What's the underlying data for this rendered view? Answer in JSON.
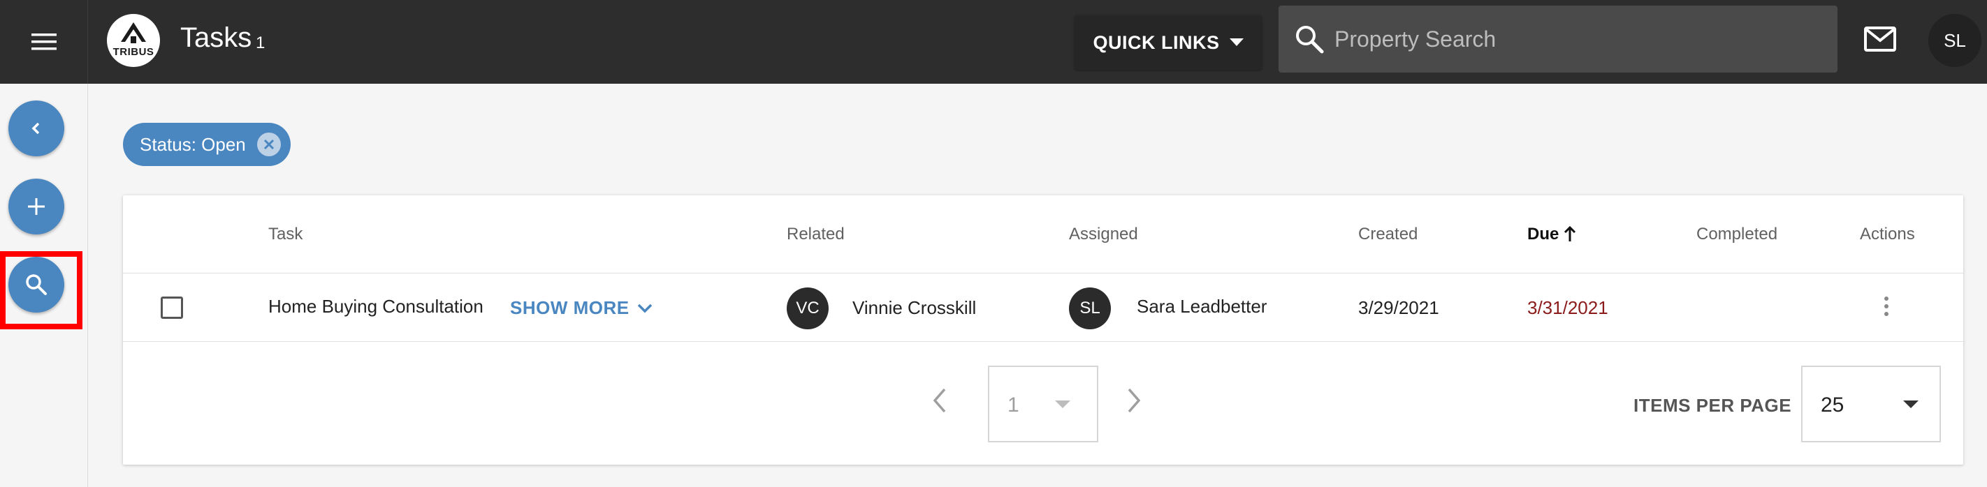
{
  "header": {
    "logo_text": "TRIBUS",
    "title": "Tasks",
    "count": "1",
    "quick_links_label": "QUICK LINKS",
    "search_placeholder": "Property Search",
    "user_initials": "SL"
  },
  "filter": {
    "chip_label": "Status: Open"
  },
  "table": {
    "columns": [
      "Task",
      "Related",
      "Assigned",
      "Created",
      "Due",
      "Completed",
      "Actions"
    ],
    "rows": [
      {
        "task": "Home Buying Consultation",
        "show_more": "SHOW MORE",
        "related_initials": "VC",
        "related_name": "Vinnie Crosskill",
        "assigned_initials": "SL",
        "assigned_name": "Sara Leadbetter",
        "created": "3/29/2021",
        "due": "3/31/2021",
        "completed": ""
      }
    ]
  },
  "pagination": {
    "page": "1",
    "items_per_page_label": "ITEMS PER PAGE",
    "items_per_page": "25"
  },
  "colors": {
    "topbar": "#2d2d2d",
    "accent": "#4a86c0",
    "due_overdue": "#8b1a1a",
    "highlight": "#ff0000"
  }
}
